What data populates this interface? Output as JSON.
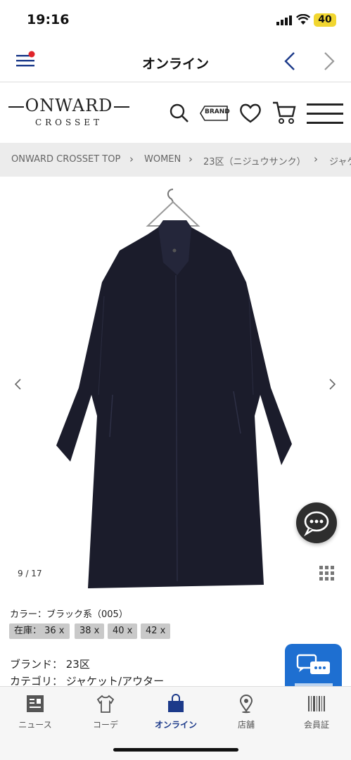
{
  "status_bar": {
    "time": "19:16",
    "battery": "40"
  },
  "app_header": {
    "title": "オンライン"
  },
  "site_header": {
    "logo_main": "ONWARD",
    "logo_sub": "CROSSET",
    "brand_button": "BRAND"
  },
  "breadcrumb": {
    "items": [
      "ONWARD CROSSET TOP",
      "WOMEN",
      "23区（ニジュウサンク）",
      "ジャケ"
    ],
    "separator": "›"
  },
  "gallery": {
    "counter": "9 / 17"
  },
  "product": {
    "color_label": "カラー：ブラック系（005）",
    "sizes": [
      "在庫： 36 x",
      "38 x",
      "40 x",
      "42 x"
    ],
    "brand_row": "ブランド： 23区",
    "category_row": "カテゴリ： ジャケット/アウター"
  },
  "tabbar": {
    "tabs": [
      {
        "label": "ニュース",
        "icon": "news-icon"
      },
      {
        "label": "コーデ",
        "icon": "tshirt-icon"
      },
      {
        "label": "オンライン",
        "icon": "shopping-bag-icon",
        "active": true
      },
      {
        "label": "店舗",
        "icon": "location-pin-icon"
      },
      {
        "label": "会員証",
        "icon": "barcode-icon"
      }
    ]
  },
  "colors": {
    "accent": "#1c3a8a",
    "fab_blue": "#1e6fd1",
    "breadcrumb_bg": "#ececec"
  }
}
